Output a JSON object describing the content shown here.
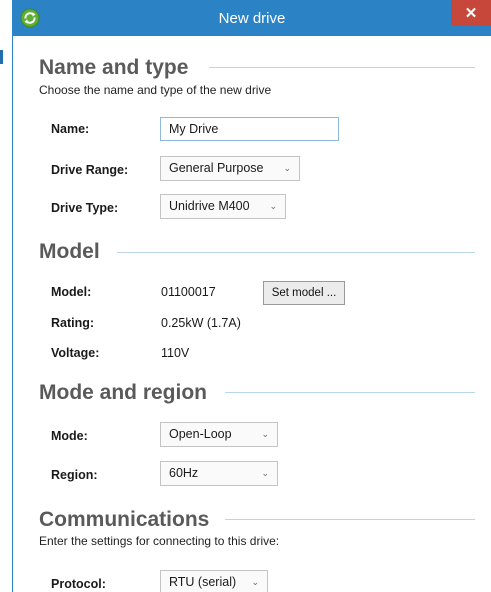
{
  "window": {
    "title": "New drive",
    "close_label": "✕"
  },
  "name_type": {
    "heading": "Name and type",
    "description": "Choose the name and type of the new drive",
    "name_label": "Name:",
    "name_value": "My Drive",
    "range_label": "Drive Range:",
    "range_value": "General Purpose",
    "type_label": "Drive Type:",
    "type_value": "Unidrive M400"
  },
  "model": {
    "heading": "Model",
    "model_label": "Model:",
    "model_value": "01100017",
    "set_model_button": "Set model ...",
    "rating_label": "Rating:",
    "rating_value": "0.25kW  (1.7A)",
    "voltage_label": "Voltage:",
    "voltage_value": "110V"
  },
  "mode_region": {
    "heading": "Mode and region",
    "mode_label": "Mode:",
    "mode_value": "Open-Loop",
    "region_label": "Region:",
    "region_value": "60Hz"
  },
  "communications": {
    "heading": "Communications",
    "description": "Enter the settings for connecting to this drive:",
    "protocol_label": "Protocol:",
    "protocol_value": "RTU (serial)"
  },
  "icons": {
    "app": "green-refresh-icon",
    "close": "close-icon",
    "dropdown": "chevron-down-icon"
  },
  "colors": {
    "titlebar": "#2b83c6",
    "close": "#c7473a",
    "heading": "#5a5a5a",
    "input_border": "#8eb9dc"
  }
}
